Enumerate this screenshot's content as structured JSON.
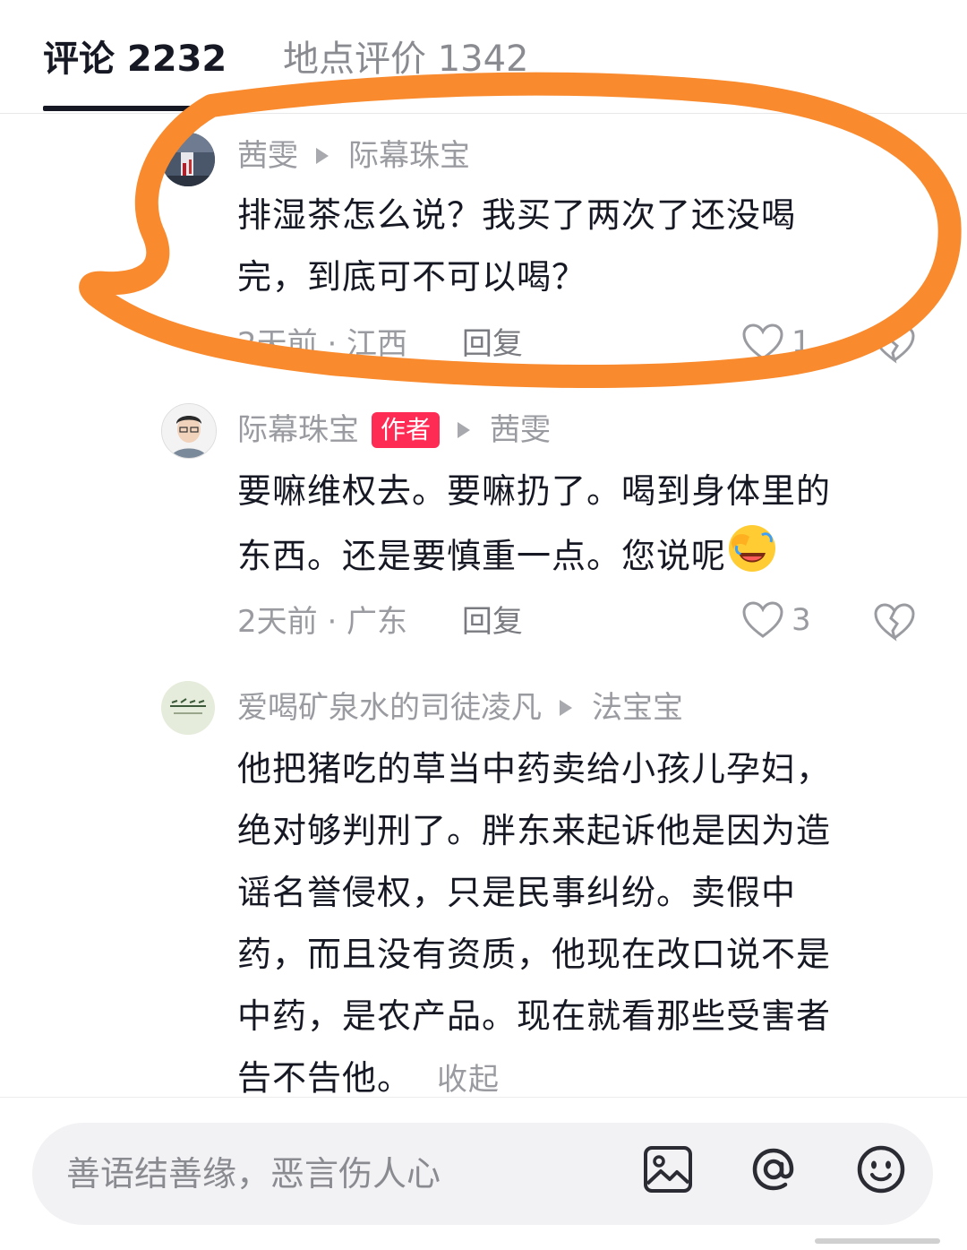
{
  "tabs": [
    {
      "label": "评论 2232",
      "active": true
    },
    {
      "label": "地点评价 1342",
      "active": false
    }
  ],
  "comments": [
    {
      "user": "茜雯",
      "reply_to": "际幕珠宝",
      "text_lines": [
        "排湿茶怎么说？我买了两次了还没喝",
        "完，到底可不可以喝？"
      ],
      "time_location": "2天前 · 江西",
      "reply_label": "回复",
      "likes": "1"
    },
    {
      "user": "际幕珠宝",
      "badge": "作者",
      "reply_to": "茜雯",
      "text_lines": [
        "要嘛维权去。要嘛扔了。喝到身体里的",
        "东西。还是要慎重一点。您说呢"
      ],
      "time_location": "2天前 · 广东",
      "reply_label": "回复",
      "likes": "3"
    },
    {
      "user": "爱喝矿泉水的司徒凌凡",
      "reply_to": "法宝宝",
      "text_lines": [
        "他把猪吃的草当中药卖给小孩儿孕妇，",
        "绝对够判刑了。胖东来起诉他是因为造",
        "谣名誉侵权，只是民事纠纷。卖假中",
        "药，而且没有资质，他现在改口说不是",
        "中药，是农产品。现在就看那些受害者",
        "告不告他。"
      ],
      "collapse_label": "收起"
    }
  ],
  "input": {
    "placeholder": "善语结善缘，恶言伤人心"
  },
  "colors": {
    "annotation": "#f98a2e",
    "author_badge": "#fe2c55"
  },
  "icons": [
    "image-icon",
    "at-icon",
    "emoji-icon",
    "heart-icon",
    "broken-heart-icon"
  ]
}
